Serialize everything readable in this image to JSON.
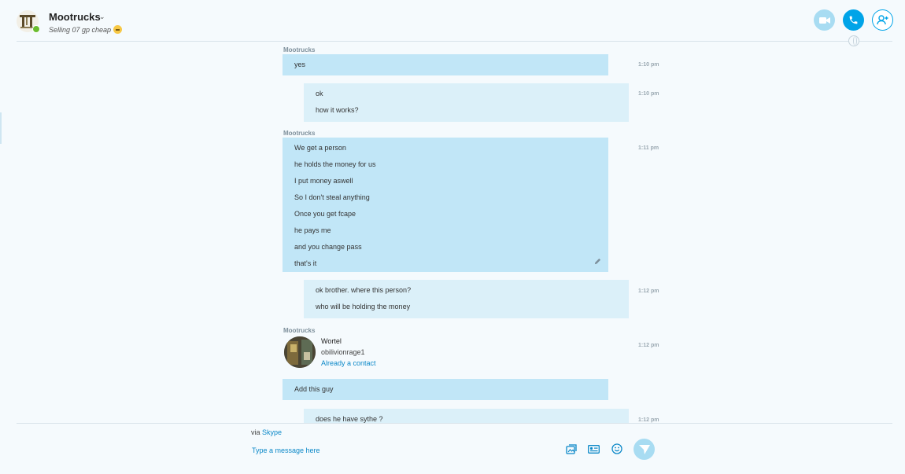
{
  "header": {
    "contact_name": "Mootrucks",
    "mood": "Selling 07 gp cheap",
    "online_status_color": "#6bbd2f",
    "accent_color": "#00a4e8",
    "buttons": {
      "video": "video-call-icon",
      "call": "phone-icon",
      "add": "add-person-icon"
    }
  },
  "messages": [
    {
      "sender": "Mootrucks",
      "direction": "in",
      "time": "1:10 pm",
      "lines": [
        "yes"
      ]
    },
    {
      "direction": "out",
      "time": "1:10 pm",
      "lines": [
        "ok",
        "how it works?"
      ]
    },
    {
      "sender": "Mootrucks",
      "direction": "in",
      "time": "1:11 pm",
      "edited": true,
      "lines": [
        "We get a person",
        "he holds the money for us",
        "I put money aswell",
        "So I don't steal anything",
        "Once you get fcape",
        "he pays me",
        "and you change pass",
        "that's it"
      ]
    },
    {
      "direction": "out",
      "time": "1:12 pm",
      "lines": [
        "ok brother. where this person?",
        "who will be holding the money"
      ]
    },
    {
      "sender": "Mootrucks",
      "direction": "in",
      "time": "1:12 pm",
      "contact_card": {
        "name": "Wortel",
        "handle": "obilivionrage1",
        "status": "Already a contact"
      }
    },
    {
      "direction": "in",
      "lines": [
        "Add this guy"
      ]
    },
    {
      "direction": "out",
      "time": "1:12 pm",
      "lines": [
        "does he have sythe ?"
      ]
    }
  ],
  "footer": {
    "via_prefix": "via",
    "via_link": "Skype",
    "composer_placeholder": "Type a message here",
    "icons": [
      "media-gallery-icon",
      "contact-card-icon",
      "emoji-icon",
      "send-icon"
    ]
  }
}
